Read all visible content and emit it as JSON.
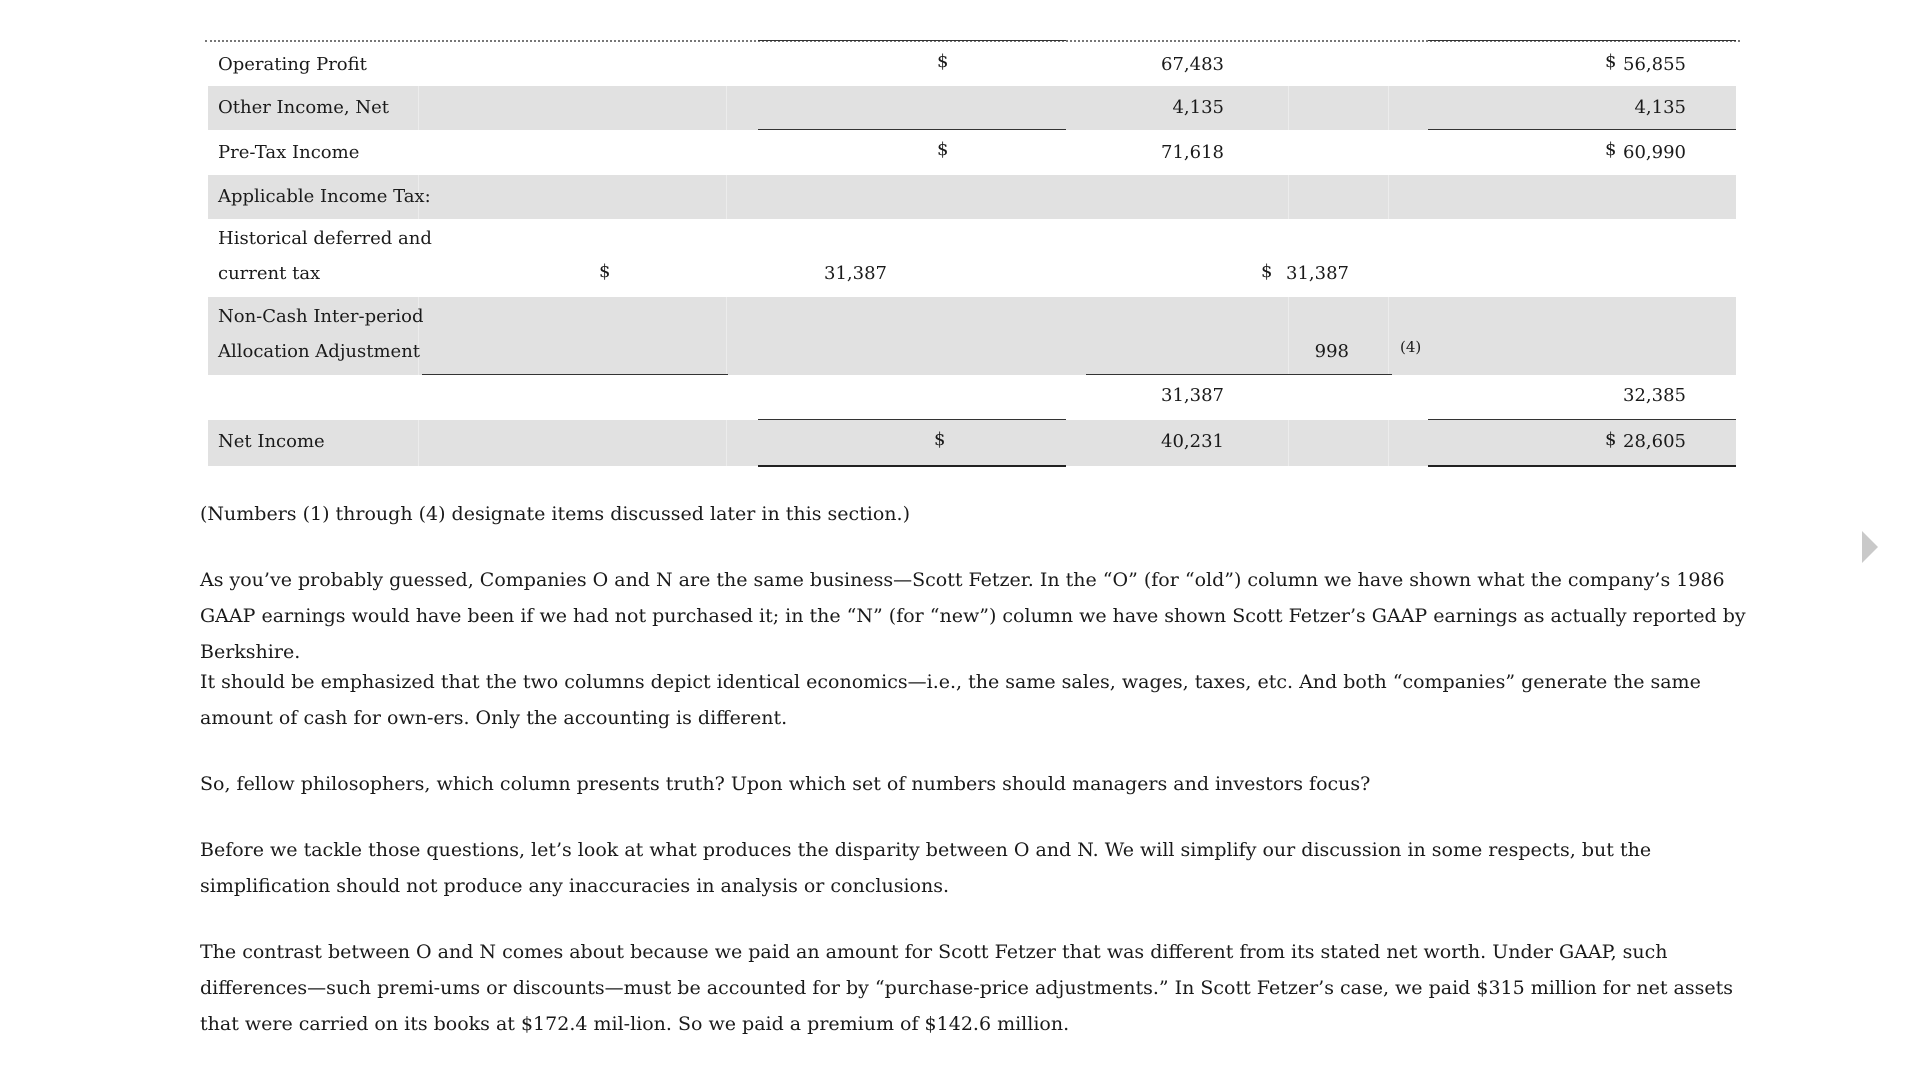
{
  "table": {
    "rows": {
      "operating_profit": {
        "label": "Operating Profit",
        "o": "67,483",
        "n": "56,855"
      },
      "other_income": {
        "label": "Other Income, Net",
        "o": "4,135",
        "n": "4,135"
      },
      "pretax_income": {
        "label": "Pre-Tax Income",
        "o": "71,618",
        "n": "60,990"
      },
      "applicable_tax": {
        "label": "Applicable Income Tax:"
      },
      "historical_tax": {
        "label_line1": "Historical deferred and",
        "label_line2": "current tax",
        "o_sub": "31,387",
        "n_sub": "31,387"
      },
      "noncash_adj": {
        "label_line1": "Non-Cash Inter-period",
        "label_line2": "Allocation Adjustment",
        "n_sub": "998",
        "note": "(4)"
      },
      "tax_total": {
        "o": "31,387",
        "n": "32,385"
      },
      "net_income": {
        "label": "Net Income",
        "o": "40,231",
        "n": "28,605"
      }
    },
    "dollar_sign": "$"
  },
  "footnote": "(Numbers (1) through (4) designate items discussed later in this section.)",
  "paragraphs": [
    "As you’ve probably guessed, Companies O and N are the same business—Scott Fetzer. In the “O” (for “old”) column we have shown what the company’s 1986 GAAP earnings would have been if we had not purchased it; in the “N” (for “new”) column we have shown Scott Fetzer’s GAAP earnings as actually reported by Berkshire.",
    "It should be emphasized that the two columns depict identical economics—i.e., the same sales, wages, taxes, etc. And both “companies” generate the same amount of cash for own-ers. Only the accounting is different.",
    "So, fellow philosophers, which column presents truth? Upon which set of numbers should managers and investors focus?",
    "Before we tackle those questions, let’s look at what produces the disparity between O and N. We will simplify our discussion in some respects, but the simplification should not produce any inaccuracies in analysis or conclusions.",
    "The contrast between O and N comes about because we paid an amount for Scott Fetzer that was different from its stated net worth. Under GAAP, such differences—such premi-ums or discounts—must be accounted for by “purchase-price adjustments.” In Scott Fetzer’s case, we paid $315 million for net assets that were carried on its books at $172.4 mil-lion. So we paid a premium of $142.6 million."
  ],
  "nav": {
    "next_icon": "triangle-right-icon"
  }
}
